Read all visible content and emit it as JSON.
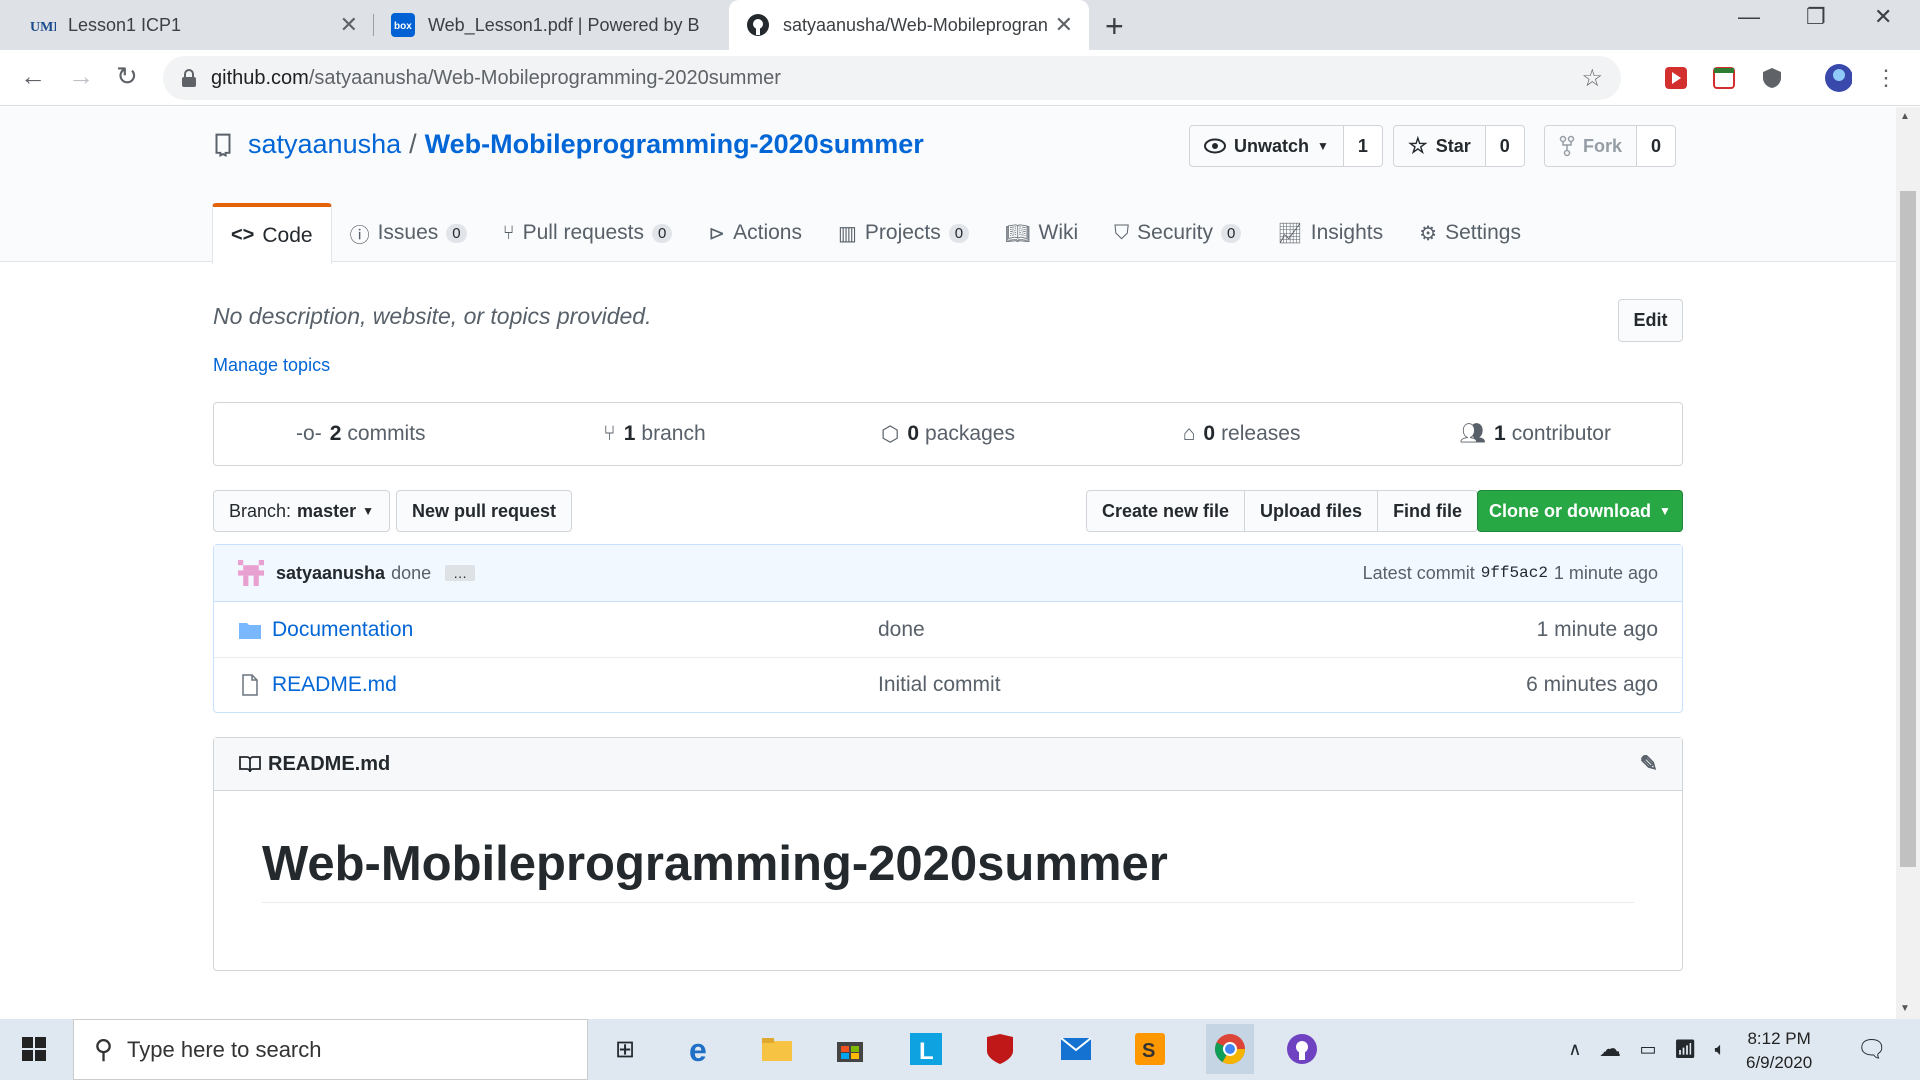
{
  "browser": {
    "tabs": [
      {
        "title": "Lesson1 ICP1",
        "icon": "umkc-icon"
      },
      {
        "title": "Web_Lesson1.pdf | Powered by B",
        "icon": "box-icon"
      },
      {
        "title": "satyaanusha/Web-Mobileprogran",
        "icon": "github-icon"
      }
    ],
    "url_domain": "github.com",
    "url_path": "/satyaanusha/Web-Mobileprogramming-2020summer"
  },
  "repo": {
    "owner": "satyaanusha",
    "separator": "/",
    "name": "Web-Mobileprogramming-2020summer",
    "watch_label": "Unwatch",
    "watch_count": "1",
    "star_label": "Star",
    "star_count": "0",
    "fork_label": "Fork",
    "fork_count": "0"
  },
  "nav": [
    {
      "label": "Code",
      "count": ""
    },
    {
      "label": "Issues",
      "count": "0"
    },
    {
      "label": "Pull requests",
      "count": "0"
    },
    {
      "label": "Actions",
      "count": ""
    },
    {
      "label": "Projects",
      "count": "0"
    },
    {
      "label": "Wiki",
      "count": ""
    },
    {
      "label": "Security",
      "count": "0"
    },
    {
      "label": "Insights",
      "count": ""
    },
    {
      "label": "Settings",
      "count": ""
    }
  ],
  "about": {
    "description": "No description, website, or topics provided.",
    "manage_topics": "Manage topics",
    "edit_label": "Edit"
  },
  "summary": [
    {
      "num": "2",
      "label": "commits"
    },
    {
      "num": "1",
      "label": "branch"
    },
    {
      "num": "0",
      "label": "packages"
    },
    {
      "num": "0",
      "label": "releases"
    },
    {
      "num": "1",
      "label": "contributor"
    }
  ],
  "toolbar": {
    "branch_prefix": "Branch:",
    "branch_name": "master",
    "new_pr": "New pull request",
    "create_file": "Create new file",
    "upload_files": "Upload files",
    "find_file": "Find file",
    "clone": "Clone or download"
  },
  "commit": {
    "author": "satyaanusha",
    "message": "done",
    "dots": "…",
    "latest_label": "Latest commit",
    "sha": "9ff5ac2",
    "age": "1 minute ago"
  },
  "files": [
    {
      "name": "Documentation",
      "type": "folder",
      "message": "done",
      "age": "1 minute ago"
    },
    {
      "name": "README.md",
      "type": "file",
      "message": "Initial commit",
      "age": "6 minutes ago"
    }
  ],
  "readme": {
    "filename": "README.md",
    "heading": "Web-Mobileprogramming-2020summer"
  },
  "taskbar": {
    "search_placeholder": "Type here to search",
    "time": "8:12 PM",
    "date": "6/9/2020"
  }
}
